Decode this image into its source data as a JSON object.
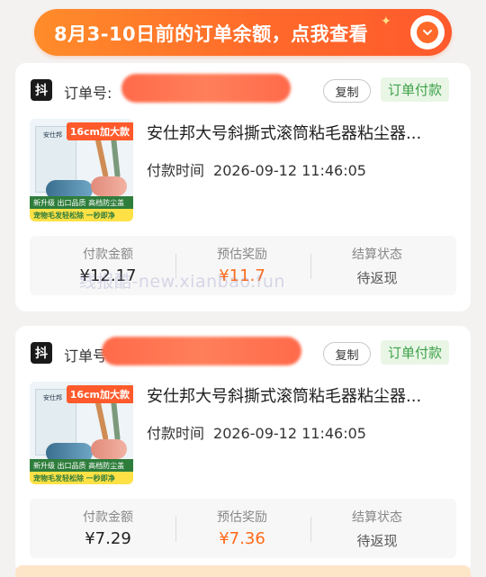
{
  "banner": {
    "text": "8月3-10日前的订单余额，点我查看"
  },
  "watermark": "线报酷-new.xianbao.fun",
  "orders": [
    {
      "platform_icon": "抖",
      "order_label": "订单号:",
      "copy_label": "复制",
      "status": "订单付款",
      "product_title": "安仕邦大号斜撕式滚筒粘毛器粘尘器...",
      "thumb": {
        "size_tag": "16cm加大款",
        "strip1": "新升级 出口品质 高档防尘盖",
        "strip2": "宠物毛发轻松除 一秒即净"
      },
      "pay_time_label": "付款时间",
      "pay_time": "2026-09-12 11:46:05",
      "amount_label": "付款金额",
      "amount": "¥12.17",
      "reward_label": "预估奖励",
      "reward": "¥11.7",
      "settle_label": "结算状态",
      "settle": "待返现"
    },
    {
      "platform_icon": "抖",
      "order_label": "订单号:",
      "copy_label": "复制",
      "status": "订单付款",
      "product_title": "安仕邦大号斜撕式滚筒粘毛器粘尘器...",
      "thumb": {
        "size_tag": "16cm加大款",
        "strip1": "新升级 出口品质 高档防尘盖",
        "strip2": "宠物毛发轻松除 一秒即净"
      },
      "pay_time_label": "付款时间",
      "pay_time": "2026-09-12 11:46:05",
      "amount_label": "付款金额",
      "amount": "¥7.29",
      "reward_label": "预估奖励",
      "reward": "¥7.36",
      "settle_label": "结算状态",
      "settle": "待返现"
    }
  ],
  "colors": {
    "accent": "#ff6a2a",
    "reward": "#ff6a1a",
    "status_green": "#3ea24a"
  }
}
